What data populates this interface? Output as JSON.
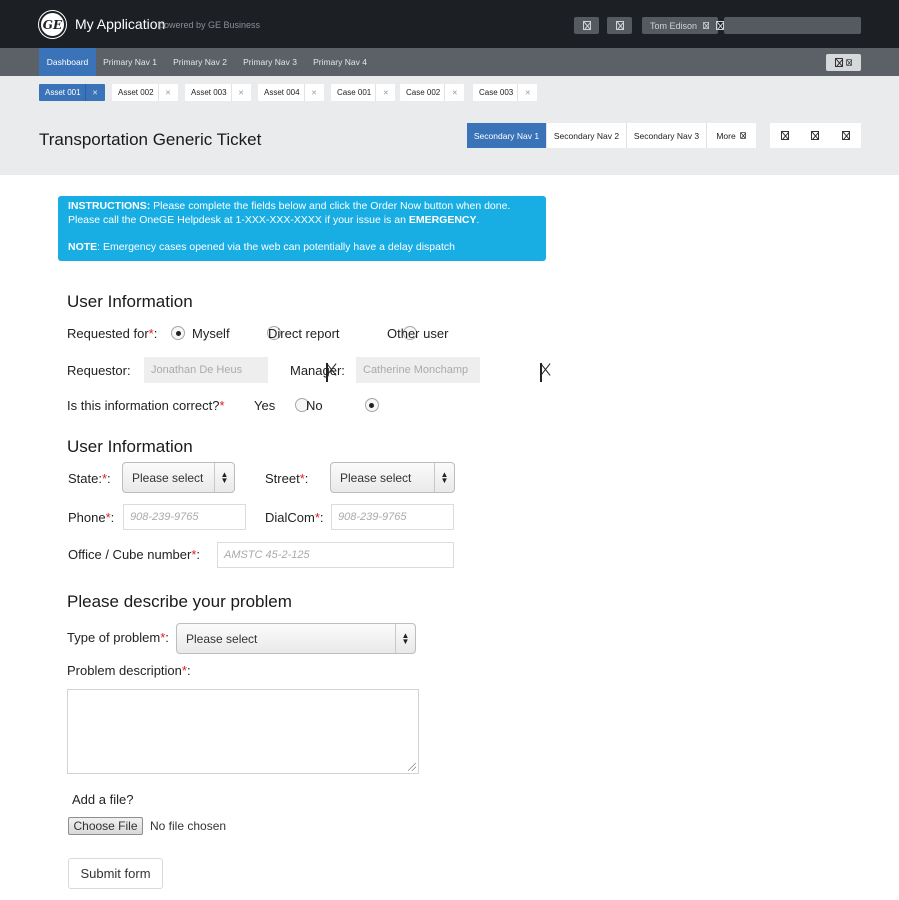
{
  "header": {
    "logo_text": "GE",
    "app_title": "My Application",
    "powered_by": "powered by GE Business",
    "user_name": "Tom Edison"
  },
  "primary_nav": [
    "Dashboard",
    "Primary Nav 1",
    "Primary Nav 2",
    "Primary Nav 3",
    "Primary Nav 4"
  ],
  "asset_tabs": [
    "Asset 001",
    "Asset 002",
    "Asset 003",
    "Asset 004",
    "Case 001",
    "Case 002",
    "Case 003"
  ],
  "page_title": "Transportation Generic Ticket",
  "secondary_nav": [
    "Secondary Nav 1",
    "Secondary Nav 2",
    "Secondary Nav 3",
    "More"
  ],
  "instructions": {
    "label1": "INSTRUCTIONS:",
    "text1": " Please complete the fields below and click the Order Now button when done.",
    "text2": "Please call the OneGE Helpdesk at 1-XXX-XXX-XXXX if your issue is an ",
    "emergency": "EMERGENCY",
    "period": ".",
    "note_label": "NOTE",
    "note_text": ": Emergency cases opened via the web can potentially have a delay dispatch"
  },
  "user_info": {
    "heading": "User Information",
    "requested_for_label": "Requested for",
    "options": [
      "Myself",
      "Direct report",
      "Other user"
    ],
    "requestor_label": "Requestor:",
    "requestor_value": "Jonathan De Heus",
    "manager_label": "Manager:",
    "manager_value": "Catherine Monchamp",
    "correct_label": "Is this information correct?",
    "yes": "Yes",
    "no": "No"
  },
  "location": {
    "heading": "User Information",
    "state_label": "State:",
    "state_select": "Please select",
    "street_label": "Street",
    "street_select": "Please select",
    "phone_label": "Phone",
    "phone_placeholder": "908-239-9765",
    "dialcom_label": "DialCom",
    "dialcom_placeholder": "908-239-9765",
    "office_label": "Office / Cube number",
    "office_placeholder": "AMSTC 45-2-125"
  },
  "problem": {
    "heading": "Please describe your problem",
    "type_label": "Type of problem",
    "type_select": "Please select",
    "desc_label": "Problem description",
    "add_file": "Add a file?",
    "choose_file": "Choose File",
    "no_file": "No file chosen",
    "submit": "Submit form"
  },
  "colors": {
    "accent": "#3b73b9",
    "info": "#19aee3",
    "required": "#e01b24",
    "topbar": "#1c1f24"
  }
}
